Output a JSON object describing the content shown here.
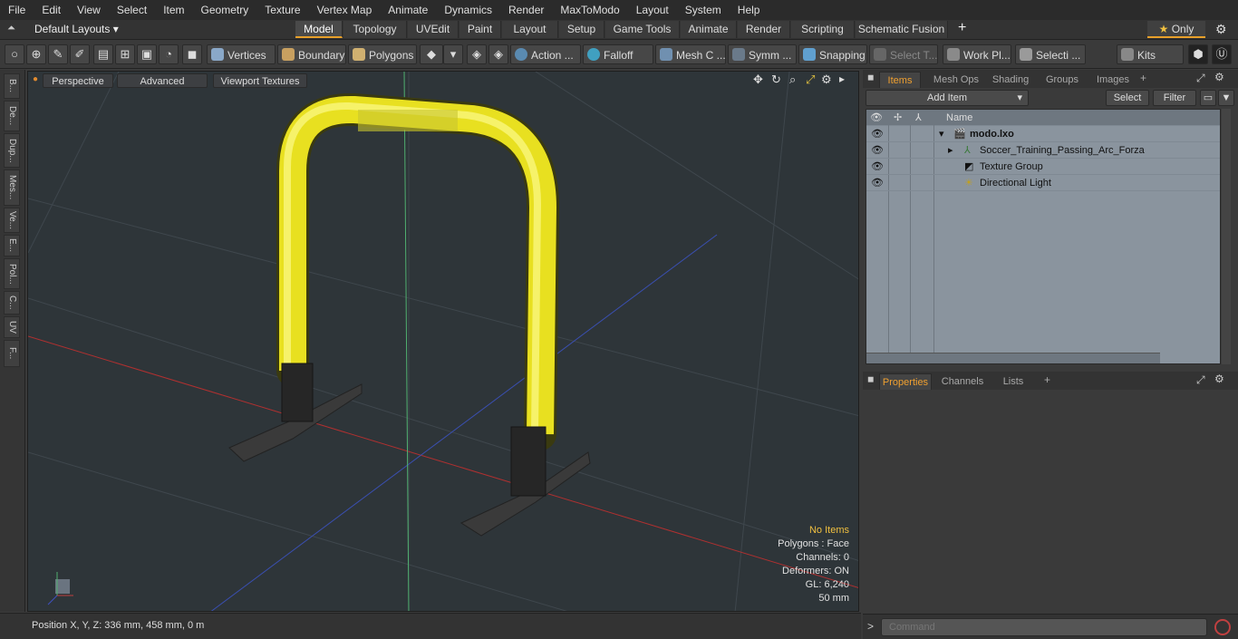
{
  "menu": [
    "File",
    "Edit",
    "View",
    "Select",
    "Item",
    "Geometry",
    "Texture",
    "Vertex Map",
    "Animate",
    "Dynamics",
    "Render",
    "MaxToModo",
    "Layout",
    "System",
    "Help"
  ],
  "layout": {
    "default": "Default Layouts ▾",
    "tabs": [
      "Model",
      "Topology",
      "UVEdit",
      "Paint",
      "Layout",
      "Setup",
      "Game Tools",
      "Animate",
      "Render",
      "Scripting",
      "Schematic Fusion"
    ],
    "active_tab": "Model",
    "add": "+",
    "only": "Only",
    "star": "★"
  },
  "toolbar": {
    "vertices": "Vertices",
    "boundary": "Boundary",
    "polygons": "Polygons",
    "action": "Action ...",
    "falloff": "Falloff",
    "meshc": "Mesh C ...",
    "symm": "Symm ...",
    "snapping": "Snapping",
    "selectt": "Select T...",
    "workpl": "Work Pl...",
    "selecti": "Selecti ...",
    "kits": "Kits"
  },
  "leftstrip": [
    "B...",
    "De...",
    "Dup...",
    "Mes...",
    "Ve...",
    "E...",
    "Pol...",
    "C...",
    "UV",
    "F..."
  ],
  "viewport": {
    "perspective": "Perspective",
    "advanced": "Advanced",
    "textures": "Viewport Textures",
    "info": {
      "items": "No Items",
      "polygons": "Polygons : Face",
      "channels": "Channels: 0",
      "deformers": "Deformers: ON",
      "gl": "GL: 6,240",
      "scale": "50 mm"
    }
  },
  "status": {
    "position": "Position X, Y, Z:  336 mm, 458 mm, 0 m"
  },
  "items_panel": {
    "tabs": [
      "Items",
      "Mesh Ops",
      "Shading",
      "Groups",
      "Images"
    ],
    "add_item": "Add Item",
    "select": "Select",
    "filter": "Filter",
    "col_name": "Name",
    "rows": [
      {
        "label": "modo.lxo",
        "bold": true
      },
      {
        "label": "Soccer_Training_Passing_Arc_Forza"
      },
      {
        "label": "Texture Group"
      },
      {
        "label": "Directional Light"
      }
    ]
  },
  "props_panel": {
    "tabs": [
      "Properties",
      "Channels",
      "Lists"
    ]
  },
  "command": {
    "placeholder": "Command",
    "prompt": ">"
  }
}
